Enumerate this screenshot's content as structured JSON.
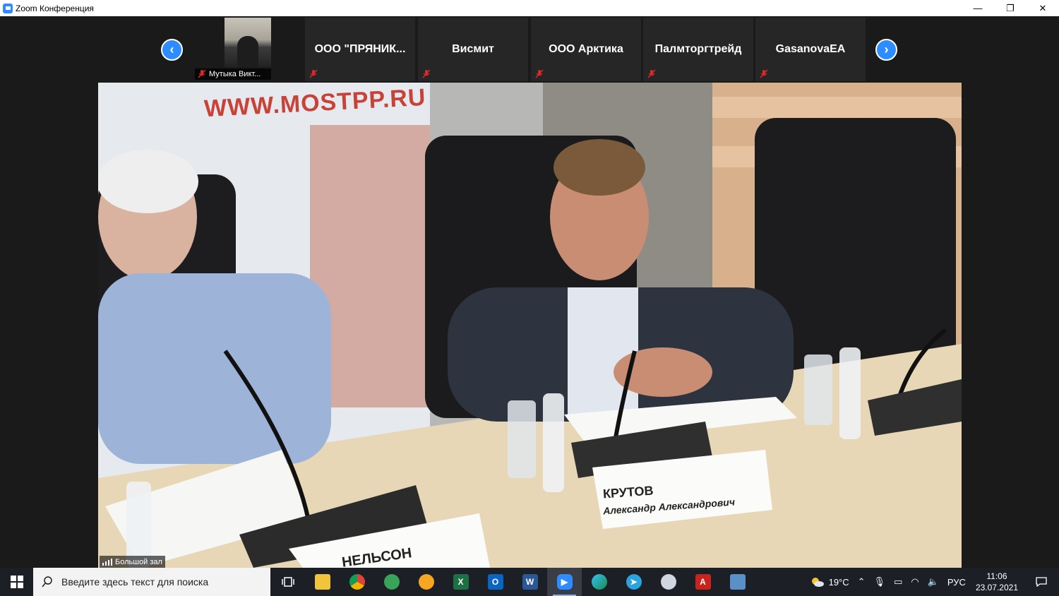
{
  "window": {
    "title": "Zoom Конференция",
    "minimize": "—",
    "maximize": "❐",
    "close": "✕"
  },
  "gallery": {
    "prev": "‹",
    "next": "›",
    "participants": [
      {
        "name": "Мутыка Викт...",
        "video": true
      },
      {
        "name": "ООО  \"ПРЯНИК...",
        "video": false
      },
      {
        "name": "Висмит",
        "video": false
      },
      {
        "name": "ООО Арктика",
        "video": false
      },
      {
        "name": "Палмторгтрейд",
        "video": false
      },
      {
        "name": "GasanovaEA",
        "video": false
      }
    ]
  },
  "main_video": {
    "label": "Большой зал",
    "banner_text": "WWW.MOSTPP.RU",
    "nameplate_center_surname": "КРУТОВ",
    "nameplate_center_name": "Александр Александрович",
    "nameplate_left": "НЕЛЬСОН"
  },
  "taskbar": {
    "search_placeholder": "Введите здесь текст для поиска",
    "apps": [
      "task-view",
      "file-explorer",
      "chrome",
      "browser-globe",
      "yandex",
      "excel",
      "outlook",
      "word",
      "zoom",
      "edge",
      "telegram",
      "paint",
      "acrobat",
      "remote-desktop"
    ],
    "active_app": "zoom",
    "weather": "19°C",
    "language": "РУС",
    "time": "11:06",
    "date": "23.07.2021"
  },
  "colors": {
    "zoom_blue": "#2d8cff",
    "taskbar": "#1c1f26",
    "mute_red": "#e02828"
  }
}
